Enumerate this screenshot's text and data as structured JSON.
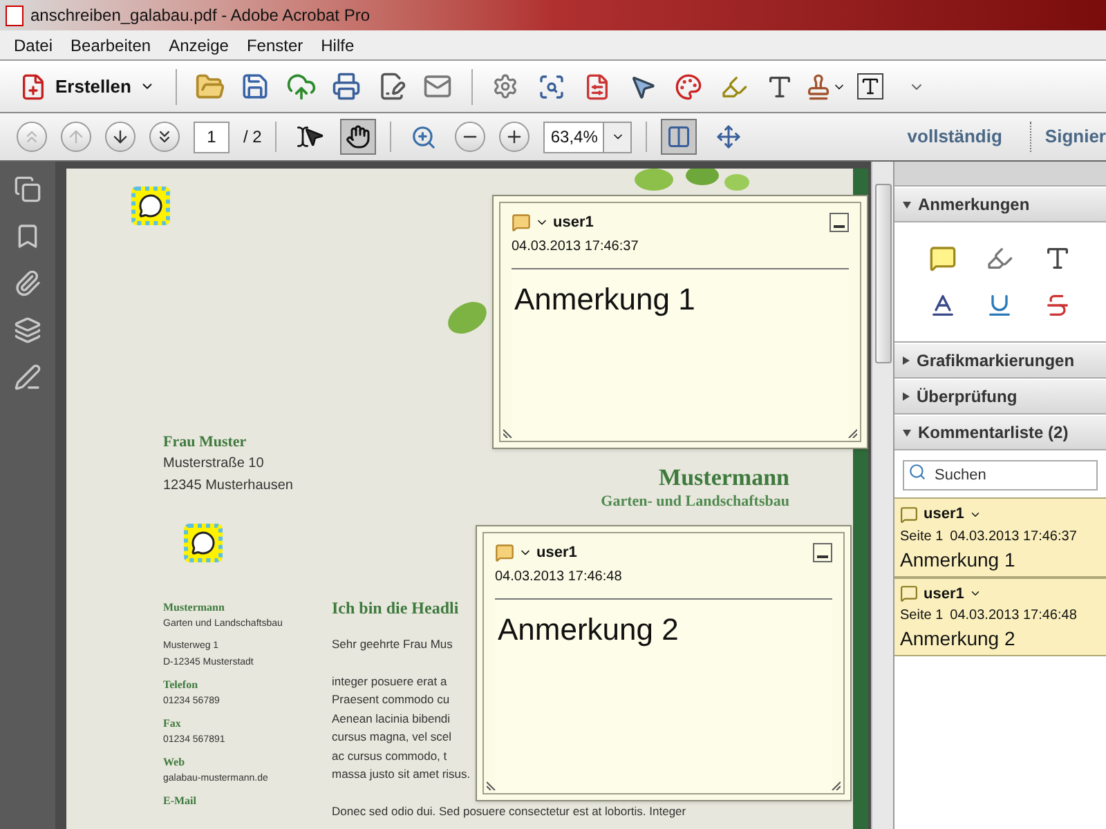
{
  "window": {
    "title": "anschreiben_galabau.pdf - Adobe Acrobat Pro"
  },
  "menu": [
    "Datei",
    "Bearbeiten",
    "Anzeige",
    "Fenster",
    "Hilfe"
  ],
  "toolbar": {
    "create_button": "Erstellen"
  },
  "nav_toolbar": {
    "page": "1",
    "page_count": "/ 2",
    "zoom": "63,4%",
    "tools": [
      {
        "kind": "select",
        "selected": false
      },
      {
        "kind": "hand",
        "selected": true
      }
    ],
    "views": [
      {
        "kind": "fit-width",
        "selected": true
      },
      {
        "kind": "fit-page",
        "selected": false
      }
    ],
    "links": [
      "vollständig",
      "Signier"
    ]
  },
  "document": {
    "recipient": {
      "name": "Frau Muster",
      "lines": [
        "Musterstraße 10",
        "12345 Musterhausen"
      ]
    },
    "letterhead": {
      "name": "Mustermann",
      "tagline": "Garten- und Landschaftsbau"
    },
    "contact": [
      {
        "label": "Mustermann",
        "lines": [
          "Garten und Landschaftsbau"
        ]
      },
      {
        "lines": [
          "Musterweg 1",
          "D-12345 Musterstadt"
        ]
      },
      {
        "label": "Telefon",
        "lines": [
          "01234 56789"
        ]
      },
      {
        "label": "Fax",
        "lines": [
          "01234 567891"
        ]
      },
      {
        "label": "Web",
        "lines": [
          "galabau-mustermann.de"
        ]
      },
      {
        "label": "E-Mail"
      }
    ],
    "headline": "Ich bin die Headli",
    "paragraphs": [
      [
        "Sehr geehrte Frau Mus"
      ],
      [
        "integer posuere erat a",
        "Praesent commodo cu",
        "Aenean lacinia bibendi",
        "cursus magna, vel scel",
        "ac cursus commodo, t",
        "massa justo sit amet risus."
      ],
      [
        "Donec sed odio dui. Sed posuere consectetur est at lobortis. Integer"
      ]
    ]
  },
  "notes": [
    {
      "author": "user1",
      "date": "04.03.2013 17:46:37",
      "text": "Anmerkung 1"
    },
    {
      "author": "user1",
      "date": "04.03.2013 17:46:48",
      "text": "Anmerkung 2"
    }
  ],
  "right_panel": {
    "sections": [
      {
        "title": "Anmerkungen",
        "expanded": true
      },
      {
        "title": "Grafikmarkierungen",
        "expanded": false
      },
      {
        "title": "Überprüfung",
        "expanded": false
      },
      {
        "title": "Kommentarliste (2)",
        "expanded": true
      }
    ],
    "search": {
      "placeholder": "Suchen"
    },
    "comments": [
      {
        "author": "user1",
        "page": "Seite 1",
        "date": "04.03.2013 17:46:37",
        "text": "Anmerkung 1"
      },
      {
        "author": "user1",
        "page": "Seite 1",
        "date": "04.03.2013 17:46:48",
        "text": "Anmerkung 2"
      }
    ]
  }
}
